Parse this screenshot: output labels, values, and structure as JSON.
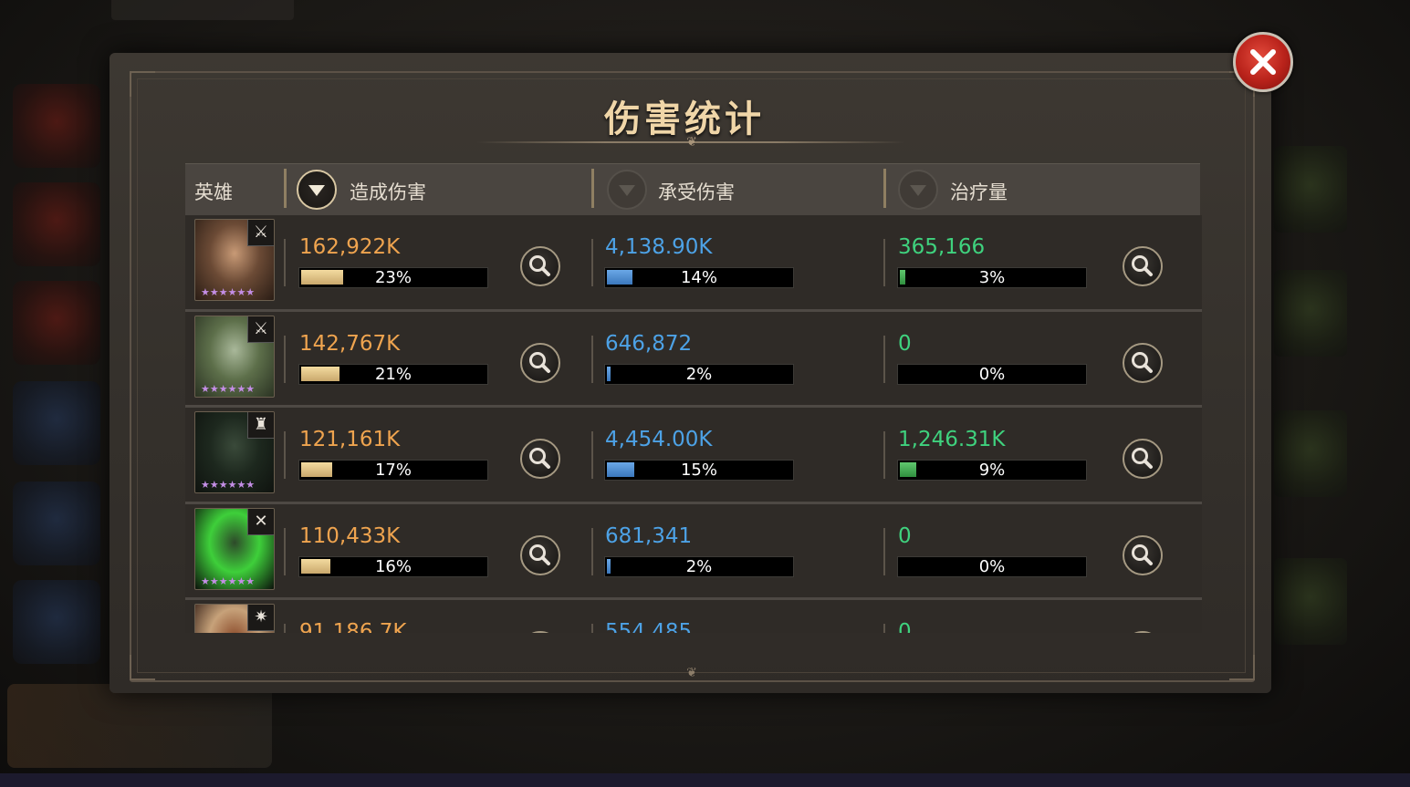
{
  "panel": {
    "title": "伤害统计"
  },
  "colors": {
    "damage": "#efa44f",
    "taken": "#4da2e6",
    "heal": "#3fd27e",
    "title": "#f0d6a8",
    "close": "#b8221a"
  },
  "header": {
    "hero_label": "英雄",
    "damage_dealt_label": "造成伤害",
    "damage_taken_label": "承受伤害",
    "healing_label": "治疗量",
    "active_sort": "damage_dealt"
  },
  "rows": [
    {
      "portrait_icon": "hero-portrait-dark-hair-woman",
      "role_icon": "sword-icon",
      "stars": "★★★★★★",
      "damage": {
        "value": "162,922K",
        "percent": "23%",
        "fraction": 0.23
      },
      "taken": {
        "value": "4,138.90K",
        "percent": "14%",
        "fraction": 0.14
      },
      "heal": {
        "value": "365,166",
        "percent": "3%",
        "fraction": 0.03
      }
    },
    {
      "portrait_icon": "hero-portrait-elf-antlers",
      "role_icon": "sword-icon",
      "stars": "★★★★★★",
      "damage": {
        "value": "142,767K",
        "percent": "21%",
        "fraction": 0.21
      },
      "taken": {
        "value": "646,872",
        "percent": "2%",
        "fraction": 0.02
      },
      "heal": {
        "value": "0",
        "percent": "0%",
        "fraction": 0
      }
    },
    {
      "portrait_icon": "hero-portrait-crowned-undead",
      "role_icon": "rook-icon",
      "stars": "★★★★★★",
      "damage": {
        "value": "121,161K",
        "percent": "17%",
        "fraction": 0.17
      },
      "taken": {
        "value": "4,454.00K",
        "percent": "15%",
        "fraction": 0.15
      },
      "heal": {
        "value": "1,246.31K",
        "percent": "9%",
        "fraction": 0.09
      }
    },
    {
      "portrait_icon": "hero-portrait-green-spiked",
      "role_icon": "crossed-axes-icon",
      "stars": "★★★★★★",
      "damage": {
        "value": "110,433K",
        "percent": "16%",
        "fraction": 0.16
      },
      "taken": {
        "value": "681,341",
        "percent": "2%",
        "fraction": 0.02
      },
      "heal": {
        "value": "0",
        "percent": "0%",
        "fraction": 0
      }
    },
    {
      "portrait_icon": "hero-portrait-bone-demon",
      "role_icon": "spark-icon",
      "stars": "★★★★★★",
      "damage": {
        "value": "91,186.7K",
        "percent": "",
        "fraction": 0
      },
      "taken": {
        "value": "554,485",
        "percent": "",
        "fraction": 0
      },
      "heal": {
        "value": "0",
        "percent": "",
        "fraction": 0
      }
    }
  ]
}
